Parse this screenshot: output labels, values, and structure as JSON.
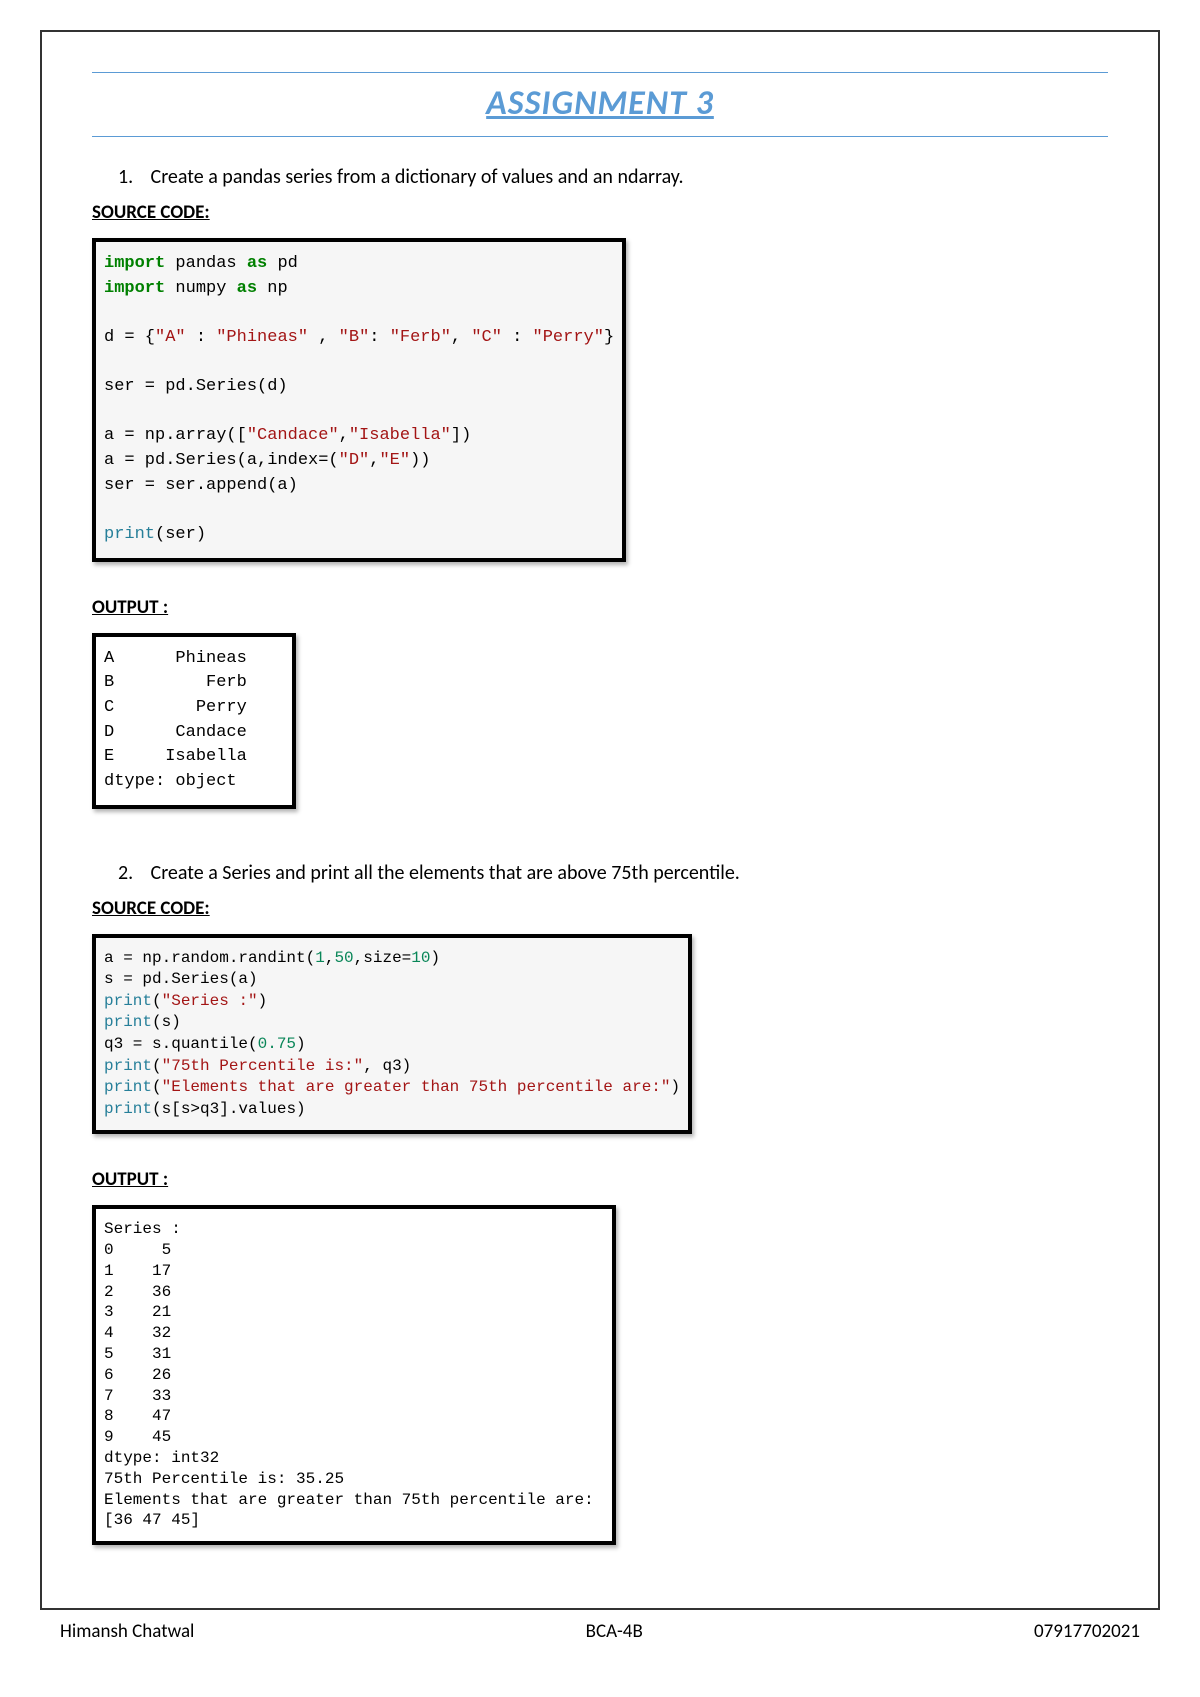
{
  "title": "ASSIGNMENT 3",
  "q1": {
    "num": "1.",
    "text": "Create a pandas series from a dictionary of values and an ndarray.",
    "source_label": "SOURCE CODE:",
    "code": {
      "l1a": "import",
      "l1b": " pandas ",
      "l1c": "as",
      "l1d": " pd",
      "l2a": "import",
      "l2b": " numpy ",
      "l2c": "as",
      "l2d": " np",
      "l4a": "d = {",
      "l4b": "\"A\"",
      "l4c": " : ",
      "l4d": "\"Phineas\"",
      "l4e": " , ",
      "l4f": "\"B\"",
      "l4g": ": ",
      "l4h": "\"Ferb\"",
      "l4i": ", ",
      "l4j": "\"C\"",
      "l4k": " : ",
      "l4l": "\"Perry\"",
      "l4m": "}",
      "l6": "ser = pd.Series(d)",
      "l8a": "a = np.array([",
      "l8b": "\"Candace\"",
      "l8c": ",",
      "l8d": "\"Isabella\"",
      "l8e": "])",
      "l9a": "a = pd.Series(a,index=(",
      "l9b": "\"D\"",
      "l9c": ",",
      "l9d": "\"E\"",
      "l9e": "))",
      "l10": "ser = ser.append(a)",
      "l12a": "print",
      "l12b": "(ser)"
    },
    "output_label": "OUTPUT :",
    "output": "A      Phineas\nB         Ferb\nC        Perry\nD      Candace\nE     Isabella\ndtype: object"
  },
  "q2": {
    "num": "2.",
    "text": "Create a Series and print all the elements that are above 75th percentile.",
    "source_label": "SOURCE CODE:",
    "code": {
      "l1a": "a = np.random.randint(",
      "l1b": "1",
      "l1c": ",",
      "l1d": "50",
      "l1e": ",size=",
      "l1f": "10",
      "l1g": ")",
      "l2": "s = pd.Series(a)",
      "l3a": "print",
      "l3b": "(",
      "l3c": "\"Series :\"",
      "l3d": ")",
      "l4a": "print",
      "l4b": "(s)",
      "l5a": "q3 = s.quantile(",
      "l5b": "0.75",
      "l5c": ")",
      "l6a": "print",
      "l6b": "(",
      "l6c": "\"75th Percentile is:\"",
      "l6d": ", q3)",
      "l7a": "print",
      "l7b": "(",
      "l7c": "\"Elements that are greater than 75th percentile are:\"",
      "l7d": ")",
      "l8a": "print",
      "l8b": "(s[s>q3].values)"
    },
    "output_label": "OUTPUT :",
    "output": "Series :\n0     5\n1    17\n2    36\n3    21\n4    32\n5    31\n6    26\n7    33\n8    47\n9    45\ndtype: int32\n75th Percentile is: 35.25\nElements that are greater than 75th percentile are:\n[36 47 45]"
  },
  "footer": {
    "name": "Himansh Chatwal",
    "class": "BCA-4B",
    "roll": "07917702021"
  }
}
